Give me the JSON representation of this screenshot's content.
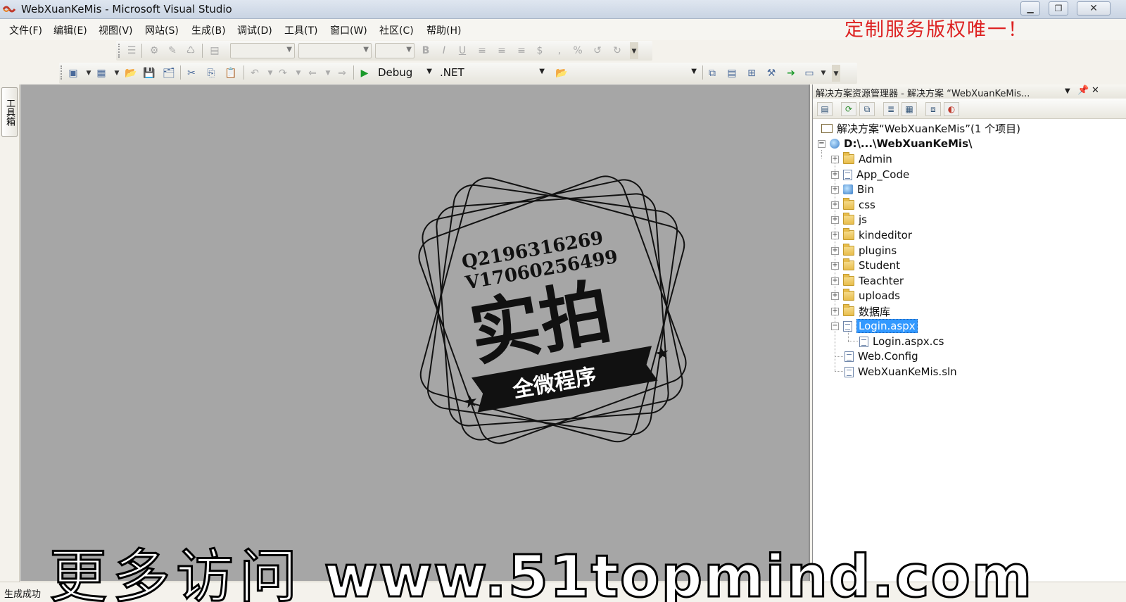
{
  "window": {
    "title": "WebXuanKeMis - Microsoft Visual Studio",
    "minimize_icon": "minimize-icon",
    "maximize_icon": "restore-icon",
    "close_icon": "close-icon"
  },
  "menu": {
    "items": [
      {
        "label": "文件(F)"
      },
      {
        "label": "编辑(E)"
      },
      {
        "label": "视图(V)"
      },
      {
        "label": "网站(S)"
      },
      {
        "label": "生成(B)"
      },
      {
        "label": "调试(D)"
      },
      {
        "label": "工具(T)"
      },
      {
        "label": "窗口(W)"
      },
      {
        "label": "社区(C)"
      },
      {
        "label": "帮助(H)"
      }
    ]
  },
  "promo": {
    "text": "定制服务版权唯一！",
    "color": "#dd2222"
  },
  "toolbar": {
    "config_label": "Debug",
    "platform_label": ".NET",
    "format_icons": [
      "bold-icon",
      "italic-icon",
      "underline-icon",
      "align-left-icon",
      "align-center-icon",
      "align-right-icon",
      "dollar-icon",
      "comma-icon",
      "percent-icon"
    ]
  },
  "toolbox": {
    "tab_label": "工具箱"
  },
  "watermark": {
    "qq": "Q2196316269",
    "wechat": "V17060256499",
    "main": "实拍",
    "banner": "全微程序",
    "bottom_cn": "更多访问",
    "bottom_url": "www.51topmind.com"
  },
  "solution_explorer": {
    "title": "解决方案资源管理器 - 解决方案 “WebXuanKeMis...",
    "pin_icon": "pin-icon",
    "close_icon": "close-icon",
    "solution_label": "解决方案“WebXuanKeMis”(1 个项目)",
    "project_label": "D:\\...\\WebXuanKeMis\\",
    "nodes": [
      {
        "label": "Admin",
        "icon": "folder-icon"
      },
      {
        "label": "App_Code",
        "icon": "app-code-folder-icon"
      },
      {
        "label": "Bin",
        "icon": "bin-folder-icon"
      },
      {
        "label": "css",
        "icon": "folder-icon"
      },
      {
        "label": "js",
        "icon": "folder-icon"
      },
      {
        "label": "kindeditor",
        "icon": "folder-icon"
      },
      {
        "label": "plugins",
        "icon": "folder-icon"
      },
      {
        "label": "Student",
        "icon": "folder-icon"
      },
      {
        "label": "Teachter",
        "icon": "folder-icon"
      },
      {
        "label": "uploads",
        "icon": "folder-icon"
      },
      {
        "label": "数据库",
        "icon": "folder-icon"
      },
      {
        "label": "Login.aspx",
        "icon": "aspx-file-icon",
        "selected": true
      },
      {
        "label": "Login.aspx.cs",
        "icon": "cs-file-icon"
      },
      {
        "label": "Web.Config",
        "icon": "config-file-icon"
      },
      {
        "label": "WebXuanKeMis.sln",
        "icon": "sln-file-icon"
      }
    ]
  },
  "status": {
    "text": "生成成功"
  }
}
